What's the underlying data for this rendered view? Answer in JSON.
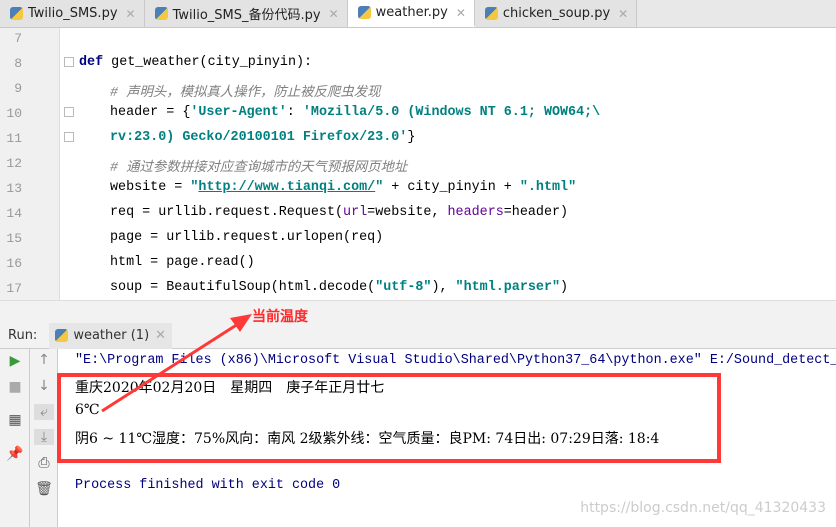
{
  "tabs": [
    {
      "label": "Twilio_SMS.py",
      "active": false
    },
    {
      "label": "Twilio_SMS_备份代码.py",
      "active": false
    },
    {
      "label": "weather.py",
      "active": true
    },
    {
      "label": "chicken_soup.py",
      "active": false
    }
  ],
  "editor": {
    "lines": [
      {
        "num": "7",
        "indent": 0,
        "tokens": []
      },
      {
        "num": "8",
        "indent": 0,
        "tokens": [
          [
            "kw",
            "def "
          ],
          [
            "t",
            "get_weather(city_pinyin):"
          ]
        ]
      },
      {
        "num": "9",
        "indent": 1,
        "tokens": [
          [
            "cm",
            "# 声明头，模拟真人操作，防止被反爬虫发现"
          ]
        ]
      },
      {
        "num": "10",
        "indent": 1,
        "tokens": [
          [
            "t",
            "header = {"
          ],
          [
            "str",
            "'User-Agent'"
          ],
          [
            "t",
            ": "
          ],
          [
            "str",
            "'Mozilla/5.0 (Windows NT 6.1; WOW64;\\"
          ]
        ]
      },
      {
        "num": "11",
        "indent": 1,
        "tokens": [
          [
            "str",
            "rv:23.0) Gecko/20100101 Firefox/23.0'"
          ],
          [
            "t",
            "}"
          ]
        ]
      },
      {
        "num": "12",
        "indent": 1,
        "tokens": [
          [
            "cm",
            "# 通过参数拼接对应查询城市的天气预报网页地址"
          ]
        ]
      },
      {
        "num": "13",
        "indent": 1,
        "tokens": [
          [
            "t",
            "website = "
          ],
          [
            "str",
            "\""
          ],
          [
            "url",
            "http://www.tianqi.com/"
          ],
          [
            "str",
            "\""
          ],
          [
            "t",
            " + city_pinyin + "
          ],
          [
            "str",
            "\".html\""
          ]
        ]
      },
      {
        "num": "14",
        "indent": 1,
        "tokens": [
          [
            "t",
            "req = urllib.request.Request("
          ],
          [
            "kwa",
            "url"
          ],
          [
            "t",
            "=website, "
          ],
          [
            "kwa",
            "headers"
          ],
          [
            "t",
            "=header)"
          ]
        ]
      },
      {
        "num": "15",
        "indent": 1,
        "tokens": [
          [
            "t",
            "page = urllib.request.urlopen(req)"
          ]
        ]
      },
      {
        "num": "16",
        "indent": 1,
        "tokens": [
          [
            "t",
            "html = page.read()"
          ]
        ]
      },
      {
        "num": "17",
        "indent": 1,
        "tokens": [
          [
            "t",
            "soup = BeautifulSoup(html.decode("
          ],
          [
            "str",
            "\"utf-8\""
          ],
          [
            "t",
            "), "
          ],
          [
            "str",
            "\"html.parser\""
          ],
          [
            "t",
            ")"
          ]
        ]
      }
    ]
  },
  "run": {
    "label": "Run:",
    "tab": "weather (1)"
  },
  "console": {
    "cmd": "\"E:\\Program Files (x86)\\Microsoft Visual Studio\\Shared\\Python37_64\\python.exe\" E:/Sound_detect_",
    "line1": "重庆2020年02月20日　星期四　庚子年正月廿七",
    "line2": "6℃",
    "line3": "阴6 ~ 11℃湿度：75%风向：南风 2级紫外线：空气质量：良PM: 74日出: 07:29日落: 18:4",
    "exit": "Process finished with exit code 0"
  },
  "annotation": {
    "label": "当前温度",
    "color": "#ff3838"
  },
  "watermark": "https://blog.csdn.net/qq_41320433"
}
